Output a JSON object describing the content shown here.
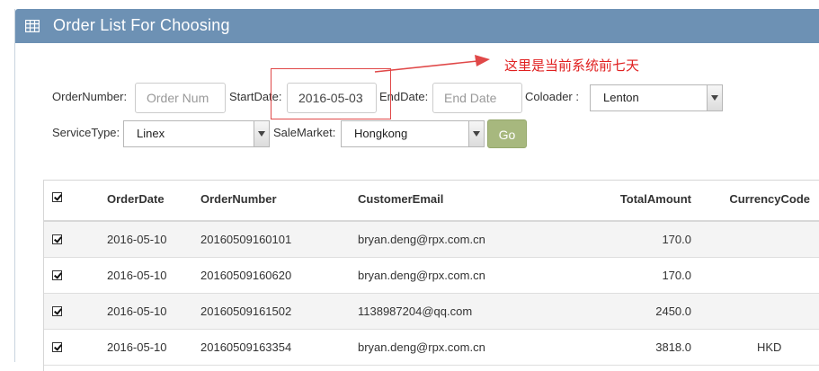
{
  "panel": {
    "title": "Order List For Choosing",
    "icon": "table-icon"
  },
  "filters": {
    "order_number_label": "OrderNumber:",
    "order_number_placeholder": "Order Num",
    "start_date_label": "StartDate:",
    "start_date_value": "2016-05-03",
    "end_date_label": "EndDate:",
    "end_date_placeholder": "End Date",
    "coloader_label": "Coloader :",
    "coloader_value": "Lenton",
    "service_type_label": "ServiceType:",
    "service_type_value": "Linex",
    "sale_market_label": "SaleMarket:",
    "sale_market_value": "Hongkong",
    "go_label": "Go"
  },
  "annotation": {
    "text": "这里是当前系统前七天",
    "color": "#e02020"
  },
  "table": {
    "columns": [
      "OrderDate",
      "OrderNumber",
      "CustomerEmail",
      "TotalAmount",
      "CurrencyCode"
    ],
    "rows": [
      {
        "checked": true,
        "OrderDate": "2016-05-10",
        "OrderNumber": "20160509160101",
        "CustomerEmail": "bryan.deng@rpx.com.cn",
        "TotalAmount": "170.0",
        "CurrencyCode": ""
      },
      {
        "checked": true,
        "OrderDate": "2016-05-10",
        "OrderNumber": "20160509160620",
        "CustomerEmail": "bryan.deng@rpx.com.cn",
        "TotalAmount": "170.0",
        "CurrencyCode": ""
      },
      {
        "checked": true,
        "OrderDate": "2016-05-10",
        "OrderNumber": "20160509161502",
        "CustomerEmail": "1138987204@qq.com",
        "TotalAmount": "2450.0",
        "CurrencyCode": ""
      },
      {
        "checked": true,
        "OrderDate": "2016-05-10",
        "OrderNumber": "20160509163354",
        "CustomerEmail": "bryan.deng@rpx.com.cn",
        "TotalAmount": "3818.0",
        "CurrencyCode": "HKD"
      }
    ]
  },
  "colors": {
    "header_bg": "#6d91b4",
    "go_button": "#a7b87e",
    "highlight": "#e04848"
  }
}
